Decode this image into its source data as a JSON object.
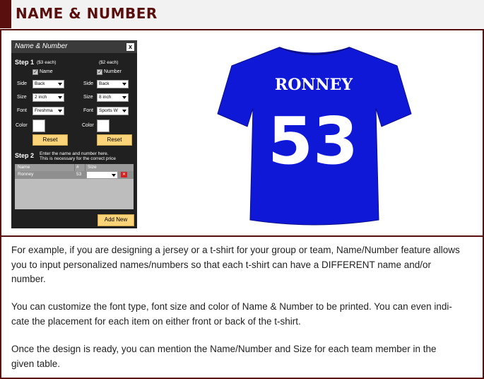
{
  "header": {
    "title": "NAME & NUMBER",
    "accent_color": "#5a0f0f"
  },
  "dialog": {
    "title": "Name & Number",
    "close_label": "x",
    "step1": {
      "label": "Step 1",
      "name_price": "($3 each)",
      "number_price": "($2 each)",
      "name_check_label": "Name",
      "number_check_label": "Number",
      "side_label": "Side",
      "size_label": "Size",
      "font_label": "Font",
      "color_label": "Color",
      "name_side": "Back",
      "number_side": "Back",
      "name_size": "2 inch",
      "number_size": "8 inch",
      "name_font": "Freshma",
      "number_font": "Sports W",
      "reset_label": "Reset"
    },
    "step2": {
      "label": "Step 2",
      "hint_line1": "Enter the name and number here.",
      "hint_line2": "This is necessary for the correct price"
    },
    "table": {
      "headers": [
        "Name",
        "#",
        "Size"
      ],
      "rows": [
        {
          "name": "Ronney",
          "number": "53",
          "size": ""
        }
      ]
    },
    "add_new_label": "Add New",
    "button_color": "#fbd47a"
  },
  "shirt": {
    "name_text": "RONNEY",
    "number_text": "53",
    "shirt_color": "#1018d8",
    "print_color": "#ffffff"
  },
  "paragraphs": {
    "p1_line1": "For example, if you are designing a jersey or a t-shirt for your group or team, Name/Number feature allows",
    "p1_line2": "you to input personalized names/numbers so that each t-shirt can have a DIFFERENT name and/or",
    "p1_line3": "number.",
    "p2_line1": "You can customize the font type, font size and color of Name & Number to be printed. You can even indi-",
    "p2_line2": "cate the placement for each item on either front or back of the t-shirt.",
    "p3_line1": "Once the design is ready, you can mention the Name/Number and Size for each team member in the",
    "p3_line2": "given table."
  }
}
